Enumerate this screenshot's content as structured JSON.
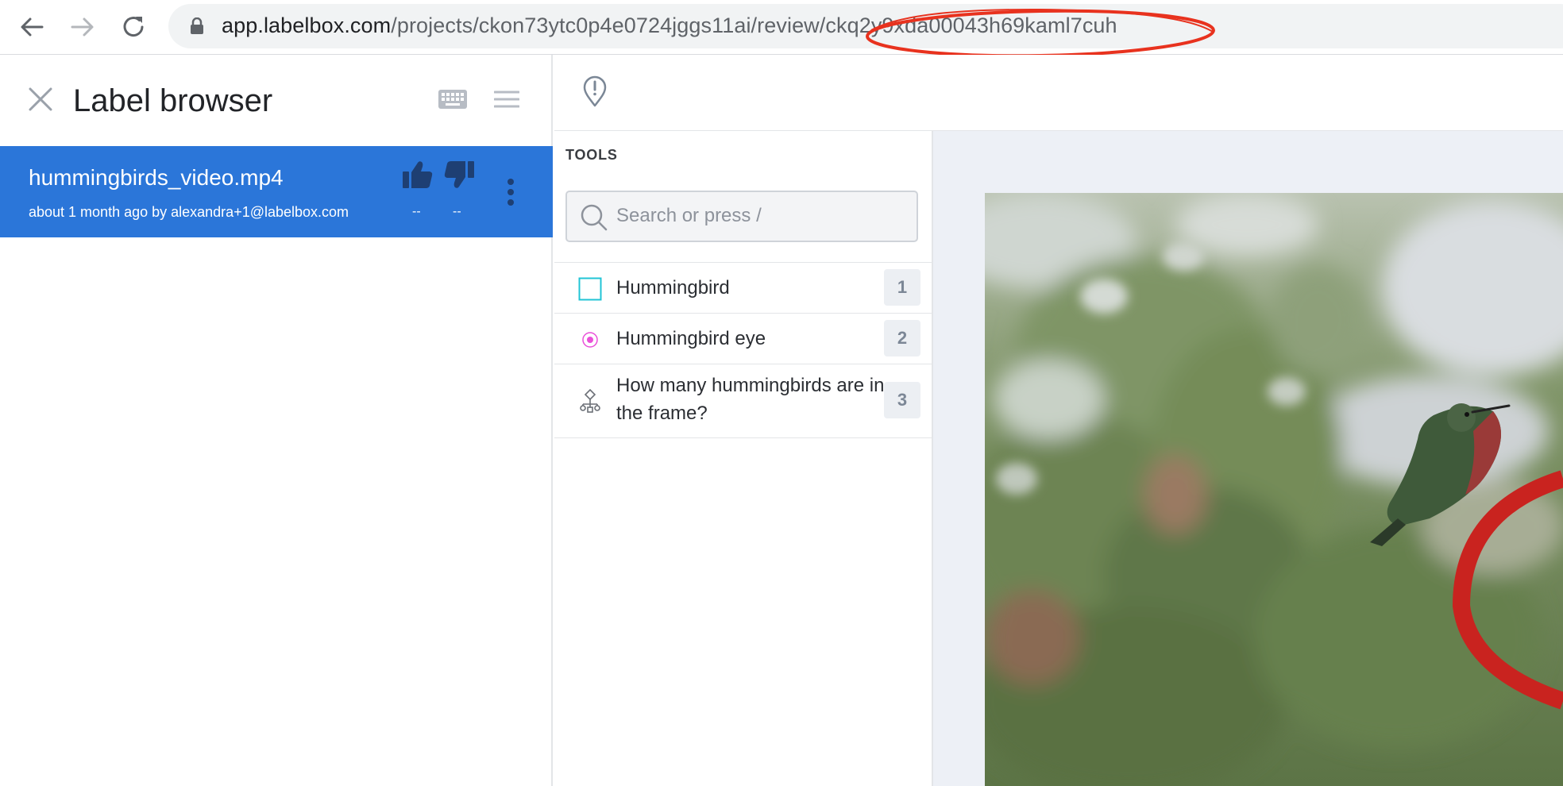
{
  "browser": {
    "url_host": "app.labelbox.com",
    "url_path": "/projects/ckon73ytc0p4e0724jggs11ai/review/",
    "url_id": "ckq2y9xda00043h69kaml7cuh"
  },
  "label_browser": {
    "title": "Label browser",
    "labels": [
      {
        "filename": "hummingbirds_video.mp4",
        "meta": "about 1 month ago by alexandra+1@labelbox.com",
        "upvotes": "--",
        "downvotes": "--"
      }
    ]
  },
  "tools": {
    "heading": "TOOLS",
    "search_placeholder": "Search or press /",
    "items": [
      {
        "label": "Hummingbird",
        "hotkey": "1",
        "icon": "bounding-box-icon",
        "color": "#21c4d6"
      },
      {
        "label": "Hummingbird eye",
        "hotkey": "2",
        "icon": "point-icon",
        "color": "#ea4fd9"
      },
      {
        "label": "How many hummingbirds are in the frame?",
        "hotkey": "3",
        "icon": "classification-icon",
        "color": "#6b6f76"
      }
    ]
  },
  "colors": {
    "selected_row": "#2b76d9",
    "annotation_circle": "#e8321e"
  }
}
